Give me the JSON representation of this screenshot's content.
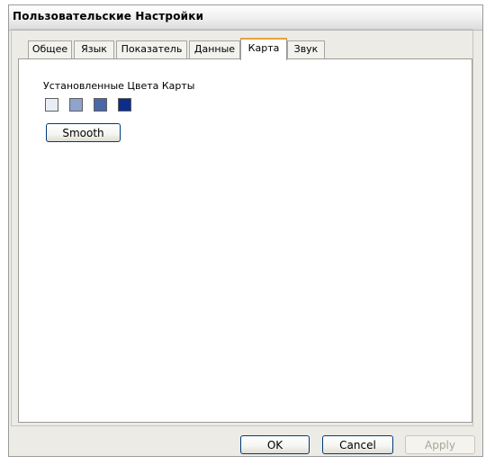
{
  "window": {
    "title": "Пользовательские Настройки"
  },
  "tabs": [
    {
      "label": "Общее",
      "active": false
    },
    {
      "label": "Язык",
      "active": false
    },
    {
      "label": "Показатель",
      "active": false
    },
    {
      "label": "Данные",
      "active": false
    },
    {
      "label": "Карта",
      "active": true
    },
    {
      "label": "Звук",
      "active": false
    }
  ],
  "map_tab": {
    "colors_label": "Установленные Цвета Карты",
    "swatch_colors": [
      "#e9edf5",
      "#8fa4cc",
      "#4a68a8",
      "#0d2d8a"
    ],
    "smooth_button": "Smooth"
  },
  "footer": {
    "ok_label": "OK",
    "cancel_label": "Cancel",
    "apply_label": "Apply"
  }
}
